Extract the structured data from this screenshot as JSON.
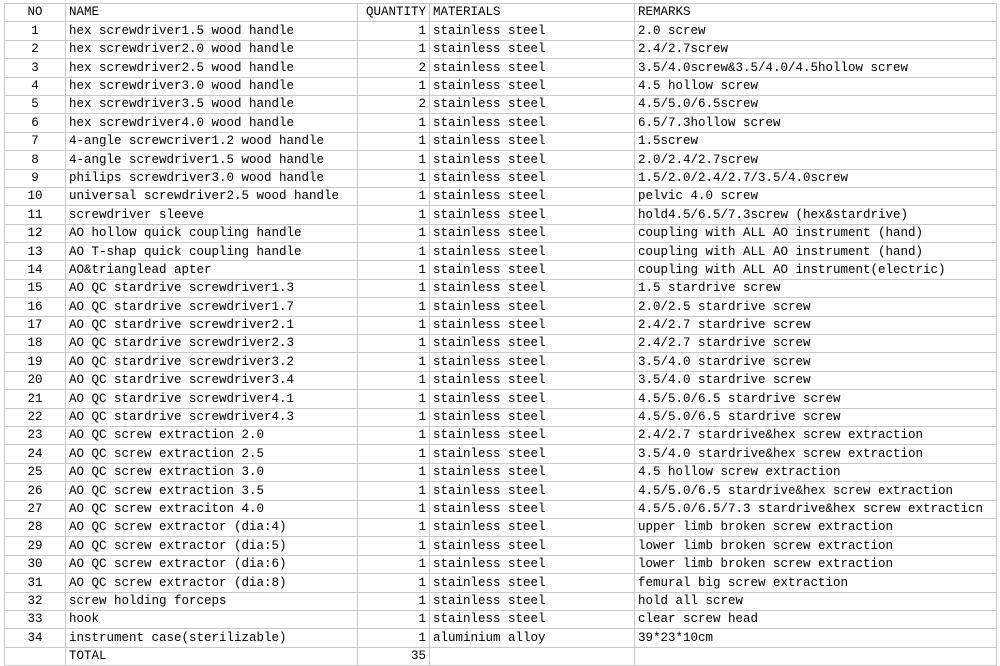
{
  "table": {
    "columns": [
      {
        "key": "no",
        "label": "NO",
        "align": "center"
      },
      {
        "key": "name",
        "label": "NAME",
        "align": "left"
      },
      {
        "key": "quantity",
        "label": "QUANTITY",
        "align": "right"
      },
      {
        "key": "materials",
        "label": "MATERIALS",
        "align": "left"
      },
      {
        "key": "remarks",
        "label": "REMARKS",
        "align": "left"
      }
    ],
    "rows": [
      {
        "no": "1",
        "name": "hex screwdriver1.5 wood handle",
        "quantity": "1",
        "materials": "stainless steel",
        "remarks": "2.0 screw"
      },
      {
        "no": "2",
        "name": "hex screwdriver2.0 wood handle",
        "quantity": "1",
        "materials": "stainless steel",
        "remarks": "2.4/2.7screw"
      },
      {
        "no": "3",
        "name": "hex screwdriver2.5 wood handle",
        "quantity": "2",
        "materials": "stainless steel",
        "remarks": "3.5/4.0screw&3.5/4.0/4.5hollow screw"
      },
      {
        "no": "4",
        "name": "hex screwdriver3.0 wood handle",
        "quantity": "1",
        "materials": "stainless steel",
        "remarks": "4.5 hollow screw"
      },
      {
        "no": "5",
        "name": "hex screwdriver3.5 wood handle",
        "quantity": "2",
        "materials": "stainless steel",
        "remarks": "4.5/5.0/6.5screw"
      },
      {
        "no": "6",
        "name": "hex screwdriver4.0 wood handle",
        "quantity": "1",
        "materials": "stainless steel",
        "remarks": "6.5/7.3hollow screw"
      },
      {
        "no": "7",
        "name": "4-angle screwcriver1.2 wood handle",
        "quantity": "1",
        "materials": "stainless steel",
        "remarks": "1.5screw"
      },
      {
        "no": "8",
        "name": "4-angle screwdriver1.5 wood handle",
        "quantity": "1",
        "materials": "stainless steel",
        "remarks": "2.0/2.4/2.7screw"
      },
      {
        "no": "9",
        "name": "philips screwdriver3.0 wood handle",
        "quantity": "1",
        "materials": "stainless steel",
        "remarks": "1.5/2.0/2.4/2.7/3.5/4.0screw"
      },
      {
        "no": "10",
        "name": "universal screwdriver2.5 wood handle",
        "quantity": "1",
        "materials": "stainless steel",
        "remarks": "pelvic 4.0 screw"
      },
      {
        "no": "11",
        "name": "screwdriver sleeve",
        "quantity": "1",
        "materials": "stainless steel",
        "remarks": "hold4.5/6.5/7.3screw (hex&stardrive)"
      },
      {
        "no": "12",
        "name": "AO hollow quick coupling handle",
        "quantity": "1",
        "materials": "stainless steel",
        "remarks": "coupling with ALL AO instrument (hand)"
      },
      {
        "no": "13",
        "name": "AO T-shap quick coupling handle",
        "quantity": "1",
        "materials": "stainless steel",
        "remarks": "coupling with ALL AO instrument (hand)"
      },
      {
        "no": "14",
        "name": "AO&trianglead apter",
        "quantity": "1",
        "materials": "stainless steel",
        "remarks": "coupling with ALL AO instrument(electric)"
      },
      {
        "no": "15",
        "name": "AO QC stardrive screwdriver1.3",
        "quantity": "1",
        "materials": "stainless steel",
        "remarks": "1.5 stardrive screw"
      },
      {
        "no": "16",
        "name": "AO QC stardrive screwdriver1.7",
        "quantity": "1",
        "materials": "stainless steel",
        "remarks": "2.0/2.5 stardrive screw"
      },
      {
        "no": "17",
        "name": "AO QC stardrive screwdriver2.1",
        "quantity": "1",
        "materials": "stainless steel",
        "remarks": "2.4/2.7 stardrive screw"
      },
      {
        "no": "18",
        "name": "AO QC stardrive screwdriver2.3",
        "quantity": "1",
        "materials": "stainless steel",
        "remarks": "2.4/2.7 stardrive screw"
      },
      {
        "no": "19",
        "name": "AO QC stardrive screwdriver3.2",
        "quantity": "1",
        "materials": "stainless steel",
        "remarks": "3.5/4.0 stardrive screw"
      },
      {
        "no": "20",
        "name": "AO QC stardrive screwdriver3.4",
        "quantity": "1",
        "materials": "stainless steel",
        "remarks": "3.5/4.0 stardrive screw"
      },
      {
        "no": "21",
        "name": "AO QC stardrive screwdriver4.1",
        "quantity": "1",
        "materials": "stainless steel",
        "remarks": "4.5/5.0/6.5 stardrive screw"
      },
      {
        "no": "22",
        "name": "AO QC stardrive screwdriver4.3",
        "quantity": "1",
        "materials": "stainless steel",
        "remarks": "4.5/5.0/6.5 stardrive screw"
      },
      {
        "no": "23",
        "name": "AO QC screw extraction 2.0",
        "quantity": "1",
        "materials": "stainless steel",
        "remarks": "2.4/2.7 stardrive&hex screw extraction"
      },
      {
        "no": "24",
        "name": "AO QC screw extraction 2.5",
        "quantity": "1",
        "materials": "stainless steel",
        "remarks": "3.5/4.0 stardrive&hex screw extraction"
      },
      {
        "no": "25",
        "name": "AO QC screw extraction 3.0",
        "quantity": "1",
        "materials": "stainless steel",
        "remarks": "4.5 hollow screw extraction"
      },
      {
        "no": "26",
        "name": "AO QC screw extraction 3.5",
        "quantity": "1",
        "materials": "stainless steel",
        "remarks": "4.5/5.0/6.5 stardrive&hex screw extraction"
      },
      {
        "no": "27",
        "name": "AO QC screw extraciton 4.0",
        "quantity": "1",
        "materials": "stainless steel",
        "remarks": "4.5/5.0/6.5/7.3 stardrive&hex screw extracticn"
      },
      {
        "no": "28",
        "name": "AO QC screw extractor (dia:4)",
        "quantity": "1",
        "materials": "stainless steel",
        "remarks": "upper limb broken screw extraction"
      },
      {
        "no": "29",
        "name": "AO QC screw extractor (dia:5)",
        "quantity": "1",
        "materials": "stainless steel",
        "remarks": "lower limb broken screw extraction"
      },
      {
        "no": "30",
        "name": "AO QC screw extractor (dia:6)",
        "quantity": "1",
        "materials": "stainless steel",
        "remarks": "lower limb broken screw extraction"
      },
      {
        "no": "31",
        "name": "AO QC screw extractor (dia:8)",
        "quantity": "1",
        "materials": "stainless steel",
        "remarks": "femural big screw extraction"
      },
      {
        "no": "32",
        "name": "screw holding forceps",
        "quantity": "1",
        "materials": "stainless steel",
        "remarks": "hold all screw"
      },
      {
        "no": "33",
        "name": "hook",
        "quantity": "1",
        "materials": "stainless steel",
        "remarks": "clear screw head"
      },
      {
        "no": "34",
        "name": "instrument case(sterilizable)",
        "quantity": "1",
        "materials": "aluminium alloy",
        "remarks": "39*23*10cm"
      }
    ],
    "total_row": {
      "no": "",
      "name": "TOTAL",
      "quantity": "35",
      "materials": "",
      "remarks": ""
    }
  },
  "colors": {
    "grid": "#c9c9c9",
    "text": "#000000",
    "background": "#ffffff"
  }
}
